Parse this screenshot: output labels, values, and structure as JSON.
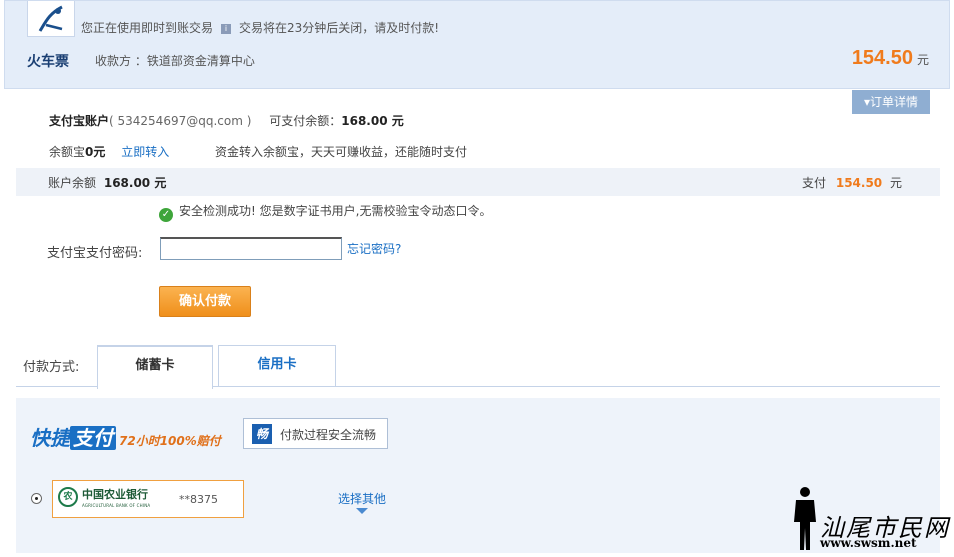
{
  "header": {
    "notice_prefix": "您正在使用即时到账交易",
    "notice_suffix": "交易将在23分钟后关闭，请及时付款!",
    "product": "火车票",
    "payee": "收款方 ：铁道部资金清算中心",
    "total_amount": "154.50",
    "total_unit": "元",
    "info_glyph": "i"
  },
  "order_detail_label": "▾订单详情",
  "account": {
    "label": "支付宝账户",
    "email": "( 534254697@qq.com )",
    "available_label": "可支付余额：",
    "available_value": "168.00 元"
  },
  "yuebao": {
    "label_prefix": "余额宝",
    "label_value": "0元",
    "transfer_link": "立即转入",
    "promo": "资金转入余额宝，天天可赚收益，还能随时支付"
  },
  "balance": {
    "label": "账户余额",
    "value": "168.00 元",
    "pay_label": "支付",
    "pay_value": "154.50",
    "pay_unit": "元"
  },
  "security": {
    "glyph": "✓",
    "message": "安全检测成功! 您是数字证书用户,无需校验宝令动态口令。"
  },
  "password": {
    "label": "支付宝支付密码:",
    "value": "",
    "forgot_link": "忘记密码?"
  },
  "confirm_button": "确认付款",
  "payment": {
    "label": "付款方式:",
    "tabs": [
      {
        "label": "储蓄卡",
        "active": true
      },
      {
        "label": "信用卡",
        "active": false
      }
    ],
    "quick_pay_a": "快捷",
    "quick_pay_b": "支付",
    "quick_pay_c": "72小时100%赔付",
    "secure_glyph": "畅",
    "secure_text": "付款过程安全流畅",
    "bank": {
      "emblem": "农",
      "name": "中国农业银行",
      "name_en": "AGRICULTURAL BANK OF CHINA",
      "card_no": "**8375"
    },
    "choose_other": "选择其他"
  },
  "watermark": {
    "text": "汕尾市民网",
    "url": "www.swsm.net"
  },
  "colors": {
    "accent": "#f07b1c",
    "link": "#1a6fc4",
    "header_bg": "#e4edf9"
  }
}
